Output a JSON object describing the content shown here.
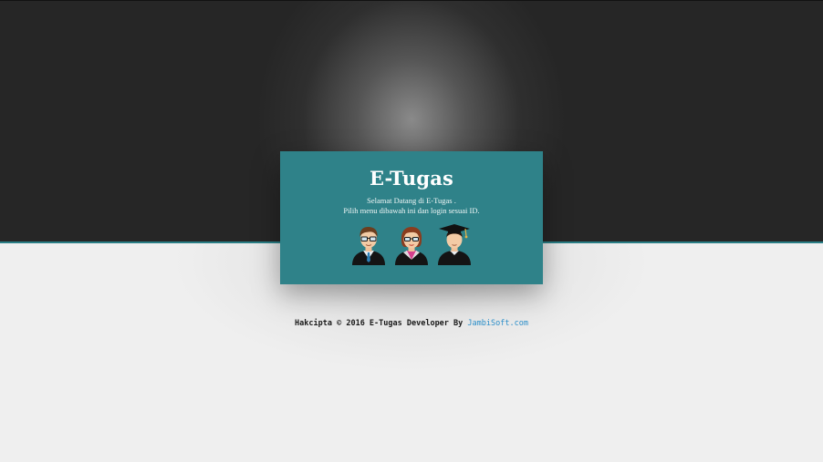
{
  "header": {
    "title": "E-Tugas",
    "welcome_line1": "Selamat Datang di E-Tugas .",
    "welcome_line2": "Pilih menu dibawah ini dan login sesuai ID."
  },
  "roles": [
    {
      "icon": "teacher-icon"
    },
    {
      "icon": "staff-woman-icon"
    },
    {
      "icon": "graduate-student-icon"
    }
  ],
  "footer": {
    "text": "Hakcipta © 2016 E-Tugas Developer By ",
    "link_label": "JambiSoft.com"
  },
  "colors": {
    "panel": "#2f8289",
    "accent_line": "#2a7f86",
    "link": "#2a8ec9",
    "top_band": "#262626"
  }
}
